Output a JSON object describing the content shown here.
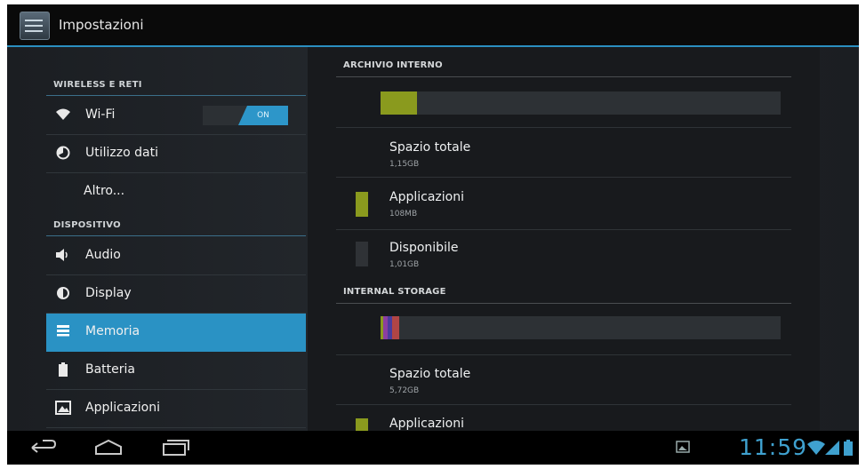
{
  "header": {
    "title": "Impostazioni",
    "icon": "settings-sliders-icon"
  },
  "sidebar": {
    "sections": [
      {
        "title": "WIRELESS E RETI"
      },
      {
        "title": "DISPOSITIVO"
      }
    ],
    "items": [
      {
        "label": "Wi-Fi",
        "icon": "wifi-icon",
        "toggle": "ON"
      },
      {
        "label": "Utilizzo dati",
        "icon": "data-usage-icon"
      },
      {
        "label": "Altro..."
      },
      {
        "label": "Audio",
        "icon": "speaker-icon"
      },
      {
        "label": "Display",
        "icon": "brightness-icon"
      },
      {
        "label": "Memoria",
        "icon": "storage-icon",
        "selected": true
      },
      {
        "label": "Batteria",
        "icon": "battery-icon"
      },
      {
        "label": "Applicazioni",
        "icon": "apps-icon"
      }
    ]
  },
  "main": {
    "internal": {
      "title": "ARCHIVIO INTERNO",
      "usage_fraction": 0.09,
      "rows": [
        {
          "title": "Spazio totale",
          "value": "1,15GB"
        },
        {
          "title": "Applicazioni",
          "value": "108MB",
          "color": "#8a9a1e"
        },
        {
          "title": "Disponibile",
          "value": "1,01GB",
          "color": "#2f3236"
        }
      ]
    },
    "storage": {
      "title": "INTERNAL STORAGE",
      "segments": [
        {
          "color": "#8a9a1e",
          "fraction": 0.006
        },
        {
          "color": "#8b3fa0",
          "fraction": 0.012
        },
        {
          "color": "#4a3c9c",
          "fraction": 0.01
        },
        {
          "color": "#b04545",
          "fraction": 0.017
        }
      ],
      "rows": [
        {
          "title": "Spazio totale",
          "value": "5,72GB"
        },
        {
          "title": "Applicazioni",
          "color": "#8a9a1e"
        }
      ]
    }
  },
  "navbar": {
    "buttons": [
      "back-icon",
      "home-icon",
      "recent-apps-icon"
    ],
    "clock": "11:59",
    "status_icons": [
      "screenshot-icon",
      "wifi-signal-icon",
      "cell-signal-icon",
      "battery-icon"
    ]
  },
  "colors": {
    "accent": "#2a92c4",
    "apps": "#8a9a1e"
  }
}
